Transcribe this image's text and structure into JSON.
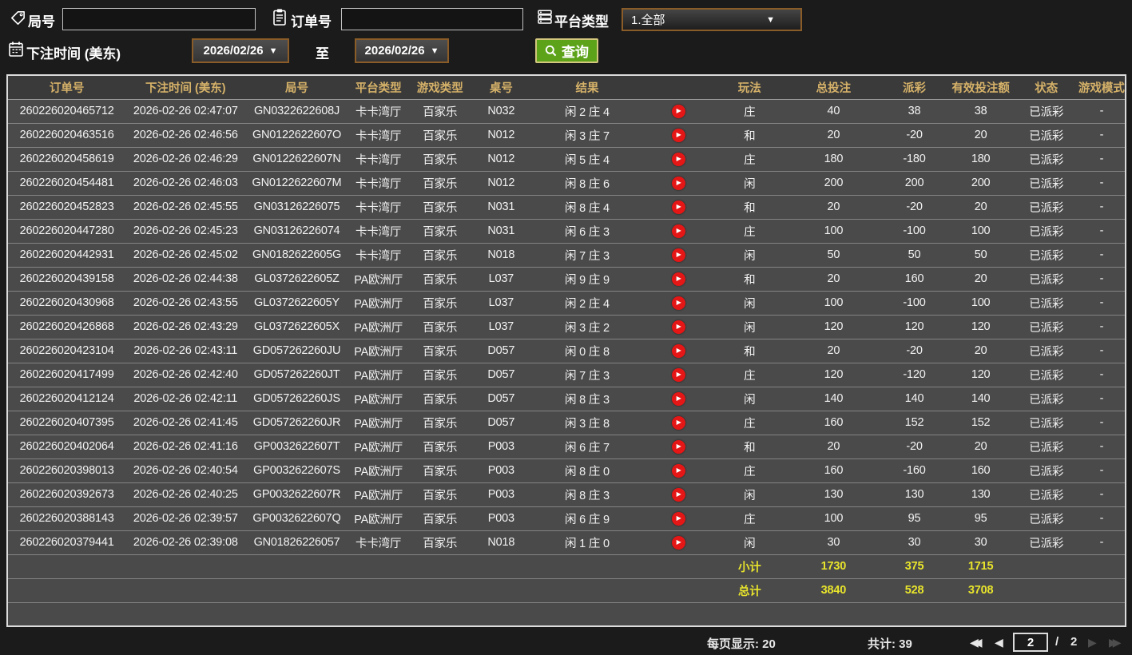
{
  "filters": {
    "game_no": {
      "label": "局号",
      "value": ""
    },
    "order_no": {
      "label": "订单号",
      "value": ""
    },
    "platform": {
      "label": "平台类型",
      "value": "1.全部"
    },
    "bet_time": {
      "label": "下注时间 (美东)",
      "from": "2026/02/26",
      "to_label": "至",
      "to": "2026/02/26"
    },
    "search_label": "查询"
  },
  "icons": {
    "caret": "▼",
    "play": "▶",
    "arrow_left": "◀",
    "arrow_right": "▶"
  },
  "table": {
    "headers": [
      "订单号",
      "下注时间 (美东)",
      "局号",
      "平台类型",
      "游戏类型",
      "桌号",
      "结果",
      "",
      "玩法",
      "总投注",
      "派彩",
      "有效投注额",
      "状态",
      "游戏模式"
    ],
    "rows": [
      {
        "order": "260226020465712",
        "time": "2026-02-26 02:47:07",
        "game_no": "GN0322622608J",
        "platform": "卡卡湾厅",
        "game_type": "百家乐",
        "table_no": "N032",
        "result": "闲 2 庄 4",
        "play_type": "庄",
        "total_bet": "40",
        "payout": "38",
        "valid_bet": "38",
        "status": "已派彩",
        "mode": "-"
      },
      {
        "order": "260226020463516",
        "time": "2026-02-26 02:46:56",
        "game_no": "GN0122622607O",
        "platform": "卡卡湾厅",
        "game_type": "百家乐",
        "table_no": "N012",
        "result": "闲 3 庄 7",
        "play_type": "和",
        "total_bet": "20",
        "payout": "-20",
        "valid_bet": "20",
        "status": "已派彩",
        "mode": "-"
      },
      {
        "order": "260226020458619",
        "time": "2026-02-26 02:46:29",
        "game_no": "GN0122622607N",
        "platform": "卡卡湾厅",
        "game_type": "百家乐",
        "table_no": "N012",
        "result": "闲 5 庄 4",
        "play_type": "庄",
        "total_bet": "180",
        "payout": "-180",
        "valid_bet": "180",
        "status": "已派彩",
        "mode": "-"
      },
      {
        "order": "260226020454481",
        "time": "2026-02-26 02:46:03",
        "game_no": "GN0122622607M",
        "platform": "卡卡湾厅",
        "game_type": "百家乐",
        "table_no": "N012",
        "result": "闲 8 庄 6",
        "play_type": "闲",
        "total_bet": "200",
        "payout": "200",
        "valid_bet": "200",
        "status": "已派彩",
        "mode": "-"
      },
      {
        "order": "260226020452823",
        "time": "2026-02-26 02:45:55",
        "game_no": "GN03126226075",
        "platform": "卡卡湾厅",
        "game_type": "百家乐",
        "table_no": "N031",
        "result": "闲 8 庄 4",
        "play_type": "和",
        "total_bet": "20",
        "payout": "-20",
        "valid_bet": "20",
        "status": "已派彩",
        "mode": "-"
      },
      {
        "order": "260226020447280",
        "time": "2026-02-26 02:45:23",
        "game_no": "GN03126226074",
        "platform": "卡卡湾厅",
        "game_type": "百家乐",
        "table_no": "N031",
        "result": "闲 6 庄 3",
        "play_type": "庄",
        "total_bet": "100",
        "payout": "-100",
        "valid_bet": "100",
        "status": "已派彩",
        "mode": "-"
      },
      {
        "order": "260226020442931",
        "time": "2026-02-26 02:45:02",
        "game_no": "GN0182622605G",
        "platform": "卡卡湾厅",
        "game_type": "百家乐",
        "table_no": "N018",
        "result": "闲 7 庄 3",
        "play_type": "闲",
        "total_bet": "50",
        "payout": "50",
        "valid_bet": "50",
        "status": "已派彩",
        "mode": "-"
      },
      {
        "order": "260226020439158",
        "time": "2026-02-26 02:44:38",
        "game_no": "GL0372622605Z",
        "platform": "PA欧洲厅",
        "game_type": "百家乐",
        "table_no": "L037",
        "result": "闲 9 庄 9",
        "play_type": "和",
        "total_bet": "20",
        "payout": "160",
        "valid_bet": "20",
        "status": "已派彩",
        "mode": "-"
      },
      {
        "order": "260226020430968",
        "time": "2026-02-26 02:43:55",
        "game_no": "GL0372622605Y",
        "platform": "PA欧洲厅",
        "game_type": "百家乐",
        "table_no": "L037",
        "result": "闲 2 庄 4",
        "play_type": "闲",
        "total_bet": "100",
        "payout": "-100",
        "valid_bet": "100",
        "status": "已派彩",
        "mode": "-"
      },
      {
        "order": "260226020426868",
        "time": "2026-02-26 02:43:29",
        "game_no": "GL0372622605X",
        "platform": "PA欧洲厅",
        "game_type": "百家乐",
        "table_no": "L037",
        "result": "闲 3 庄 2",
        "play_type": "闲",
        "total_bet": "120",
        "payout": "120",
        "valid_bet": "120",
        "status": "已派彩",
        "mode": "-"
      },
      {
        "order": "260226020423104",
        "time": "2026-02-26 02:43:11",
        "game_no": "GD057262260JU",
        "platform": "PA欧洲厅",
        "game_type": "百家乐",
        "table_no": "D057",
        "result": "闲 0 庄 8",
        "play_type": "和",
        "total_bet": "20",
        "payout": "-20",
        "valid_bet": "20",
        "status": "已派彩",
        "mode": "-"
      },
      {
        "order": "260226020417499",
        "time": "2026-02-26 02:42:40",
        "game_no": "GD057262260JT",
        "platform": "PA欧洲厅",
        "game_type": "百家乐",
        "table_no": "D057",
        "result": "闲 7 庄 3",
        "play_type": "庄",
        "total_bet": "120",
        "payout": "-120",
        "valid_bet": "120",
        "status": "已派彩",
        "mode": "-"
      },
      {
        "order": "260226020412124",
        "time": "2026-02-26 02:42:11",
        "game_no": "GD057262260JS",
        "platform": "PA欧洲厅",
        "game_type": "百家乐",
        "table_no": "D057",
        "result": "闲 8 庄 3",
        "play_type": "闲",
        "total_bet": "140",
        "payout": "140",
        "valid_bet": "140",
        "status": "已派彩",
        "mode": "-"
      },
      {
        "order": "260226020407395",
        "time": "2026-02-26 02:41:45",
        "game_no": "GD057262260JR",
        "platform": "PA欧洲厅",
        "game_type": "百家乐",
        "table_no": "D057",
        "result": "闲 3 庄 8",
        "play_type": "庄",
        "total_bet": "160",
        "payout": "152",
        "valid_bet": "152",
        "status": "已派彩",
        "mode": "-"
      },
      {
        "order": "260226020402064",
        "time": "2026-02-26 02:41:16",
        "game_no": "GP0032622607T",
        "platform": "PA欧洲厅",
        "game_type": "百家乐",
        "table_no": "P003",
        "result": "闲 6 庄 7",
        "play_type": "和",
        "total_bet": "20",
        "payout": "-20",
        "valid_bet": "20",
        "status": "已派彩",
        "mode": "-"
      },
      {
        "order": "260226020398013",
        "time": "2026-02-26 02:40:54",
        "game_no": "GP0032622607S",
        "platform": "PA欧洲厅",
        "game_type": "百家乐",
        "table_no": "P003",
        "result": "闲 8 庄 0",
        "play_type": "庄",
        "total_bet": "160",
        "payout": "-160",
        "valid_bet": "160",
        "status": "已派彩",
        "mode": "-"
      },
      {
        "order": "260226020392673",
        "time": "2026-02-26 02:40:25",
        "game_no": "GP0032622607R",
        "platform": "PA欧洲厅",
        "game_type": "百家乐",
        "table_no": "P003",
        "result": "闲 8 庄 3",
        "play_type": "闲",
        "total_bet": "130",
        "payout": "130",
        "valid_bet": "130",
        "status": "已派彩",
        "mode": "-"
      },
      {
        "order": "260226020388143",
        "time": "2026-02-26 02:39:57",
        "game_no": "GP0032622607Q",
        "platform": "PA欧洲厅",
        "game_type": "百家乐",
        "table_no": "P003",
        "result": "闲 6 庄 9",
        "play_type": "庄",
        "total_bet": "100",
        "payout": "95",
        "valid_bet": "95",
        "status": "已派彩",
        "mode": "-"
      },
      {
        "order": "260226020379441",
        "time": "2026-02-26 02:39:08",
        "game_no": "GN01826226057",
        "platform": "卡卡湾厅",
        "game_type": "百家乐",
        "table_no": "N018",
        "result": "闲 1 庄 0",
        "play_type": "闲",
        "total_bet": "30",
        "payout": "30",
        "valid_bet": "30",
        "status": "已派彩",
        "mode": "-"
      }
    ],
    "subtotal": {
      "label": "小计",
      "total_bet": "1730",
      "payout": "375",
      "valid_bet": "1715"
    },
    "grand_total": {
      "label": "总计",
      "total_bet": "3840",
      "payout": "528",
      "valid_bet": "3708"
    }
  },
  "pagination": {
    "per_page": "每页显示: 20",
    "total_count": "共计: 39",
    "current_page": "2",
    "separator": "/",
    "total_pages": "2"
  },
  "colors": {
    "header_text": "#d6b269",
    "payout_win": "#b01526",
    "payout_loss": "#3fd43f",
    "status_paid": "#2fd32f",
    "totals_text": "#e8e42c",
    "accent_border": "#8a5c28",
    "search_button": "#5ca31a"
  }
}
